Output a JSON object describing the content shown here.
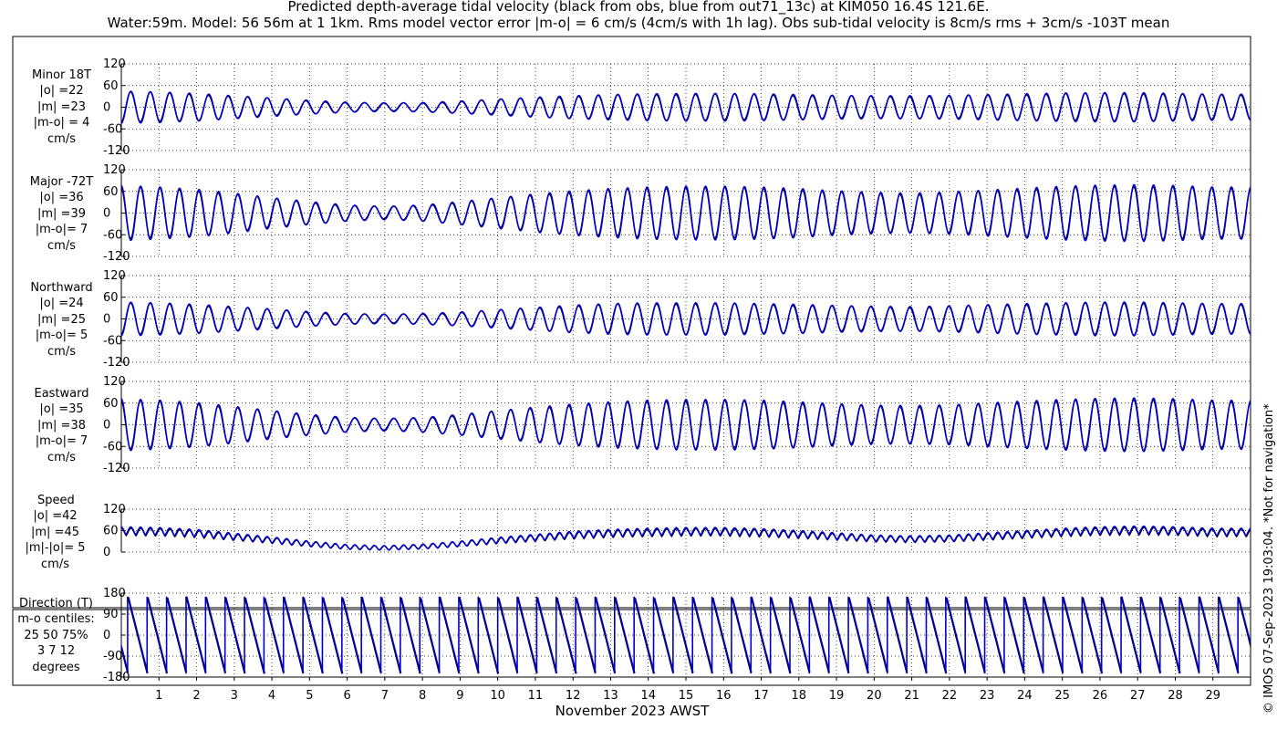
{
  "title_line1": "Predicted depth-average tidal velocity (black from obs, blue from out71_13c) at KIM050 16.4S 121.6E.",
  "title_line2": "Water:59m. Model: 56 56m at 1 1km. Rms model vector error |m-o| = 6 cm/s (4cm/s with 1h lag). Obs sub-tidal velocity is 8cm/s rms + 3cm/s -103T mean",
  "credit": "© IMOS 07-Sep-2023 19:03:04. *Not for navigation*",
  "xlabel": "November 2023 AWST",
  "chart_data": {
    "type": "line",
    "x": {
      "label": "November 2023 AWST",
      "unit": "day",
      "range": [
        0,
        30
      ],
      "ticks": [
        1,
        2,
        3,
        4,
        5,
        6,
        7,
        8,
        9,
        10,
        11,
        12,
        13,
        14,
        15,
        16,
        17,
        18,
        19,
        20,
        21,
        22,
        23,
        24,
        25,
        26,
        27,
        28,
        29
      ]
    },
    "series_legend": {
      "black": "obs",
      "blue": "out71_13c"
    },
    "colors": {
      "obs": "#000000",
      "model": "#0000cc"
    },
    "grid": true,
    "panels": [
      {
        "id": "minor",
        "label": [
          "Minor 18T",
          "|o| =22",
          "|m| =23",
          "|m-o| = 4",
          "cm/s"
        ],
        "ylim": [
          -120,
          120
        ],
        "yticks": [
          -120,
          -60,
          0,
          60,
          120
        ],
        "ytick_labels": [
          "-120",
          "-60",
          "0",
          "60",
          "120"
        ],
        "kind": "vel",
        "amp_o": [
          42,
          40,
          36,
          30,
          24,
          18,
          13,
          11,
          12,
          16,
          21,
          26,
          30,
          33,
          35,
          36,
          36,
          35,
          33,
          31,
          30,
          30,
          31,
          33,
          35,
          37,
          38,
          38,
          36,
          34
        ]
      },
      {
        "id": "major",
        "label": [
          "Major -72T",
          "|o| =36",
          "|m| =39",
          "|m-o|= 7",
          "cm/s"
        ],
        "ylim": [
          -120,
          120
        ],
        "yticks": [
          -120,
          -60,
          0,
          60,
          120
        ],
        "ytick_labels": [
          "-120",
          "-60",
          "0",
          "60",
          "120"
        ],
        "kind": "vel",
        "amp_o": [
          72,
          68,
          62,
          52,
          40,
          30,
          21,
          17,
          21,
          30,
          40,
          50,
          58,
          64,
          68,
          70,
          70,
          68,
          64,
          58,
          54,
          52,
          55,
          60,
          65,
          70,
          73,
          74,
          72,
          68
        ]
      },
      {
        "id": "north",
        "label": [
          "Northward",
          "|o| =24",
          "|m| =25",
          "|m-o|= 5",
          "cm/s"
        ],
        "ylim": [
          -120,
          120
        ],
        "yticks": [
          -120,
          -60,
          0,
          60,
          120
        ],
        "ytick_labels": [
          "-120",
          "-60",
          "0",
          "60",
          "120"
        ],
        "kind": "vel",
        "amp_o": [
          44,
          42,
          38,
          32,
          26,
          19,
          14,
          12,
          14,
          18,
          24,
          30,
          36,
          40,
          42,
          42,
          42,
          40,
          38,
          35,
          33,
          32,
          34,
          37,
          40,
          42,
          44,
          44,
          42,
          40
        ]
      },
      {
        "id": "east",
        "label": [
          "Eastward",
          "|o| =35",
          "|m| =38",
          "|m-o|= 7",
          "cm/s"
        ],
        "ylim": [
          -120,
          120
        ],
        "yticks": [
          -120,
          -60,
          0,
          60,
          120
        ],
        "ytick_labels": [
          "-120",
          "-60",
          "0",
          "60",
          "120"
        ],
        "kind": "vel",
        "amp_o": [
          68,
          64,
          58,
          48,
          37,
          27,
          19,
          16,
          19,
          27,
          37,
          46,
          54,
          60,
          64,
          66,
          66,
          64,
          60,
          55,
          51,
          50,
          52,
          57,
          62,
          66,
          69,
          70,
          68,
          64
        ]
      },
      {
        "id": "speed",
        "label": [
          "Speed",
          "|o| =42",
          "|m| =45",
          "|m|-|o|= 5",
          "cm/s"
        ],
        "ylim": [
          0,
          120
        ],
        "yticks": [
          0,
          60,
          120
        ],
        "ytick_labels": [
          "0",
          "60",
          "120"
        ],
        "kind": "speed",
        "mean": [
          62,
          60,
          55,
          45,
          35,
          24,
          15,
          12,
          16,
          24,
          34,
          42,
          50,
          55,
          58,
          60,
          60,
          57,
          52,
          46,
          40,
          38,
          40,
          46,
          52,
          58,
          62,
          64,
          62,
          58
        ]
      },
      {
        "id": "direction",
        "label": [
          "Direction (T)",
          "m-o centiles:",
          "25  50  75%",
          "3   7  12",
          "degrees"
        ],
        "ylim": [
          -180,
          180
        ],
        "yticks": [
          -180,
          -90,
          0,
          90,
          180
        ],
        "ytick_labels": [
          "-180",
          "-90",
          "0",
          "90",
          "180"
        ],
        "kind": "dir"
      }
    ]
  }
}
